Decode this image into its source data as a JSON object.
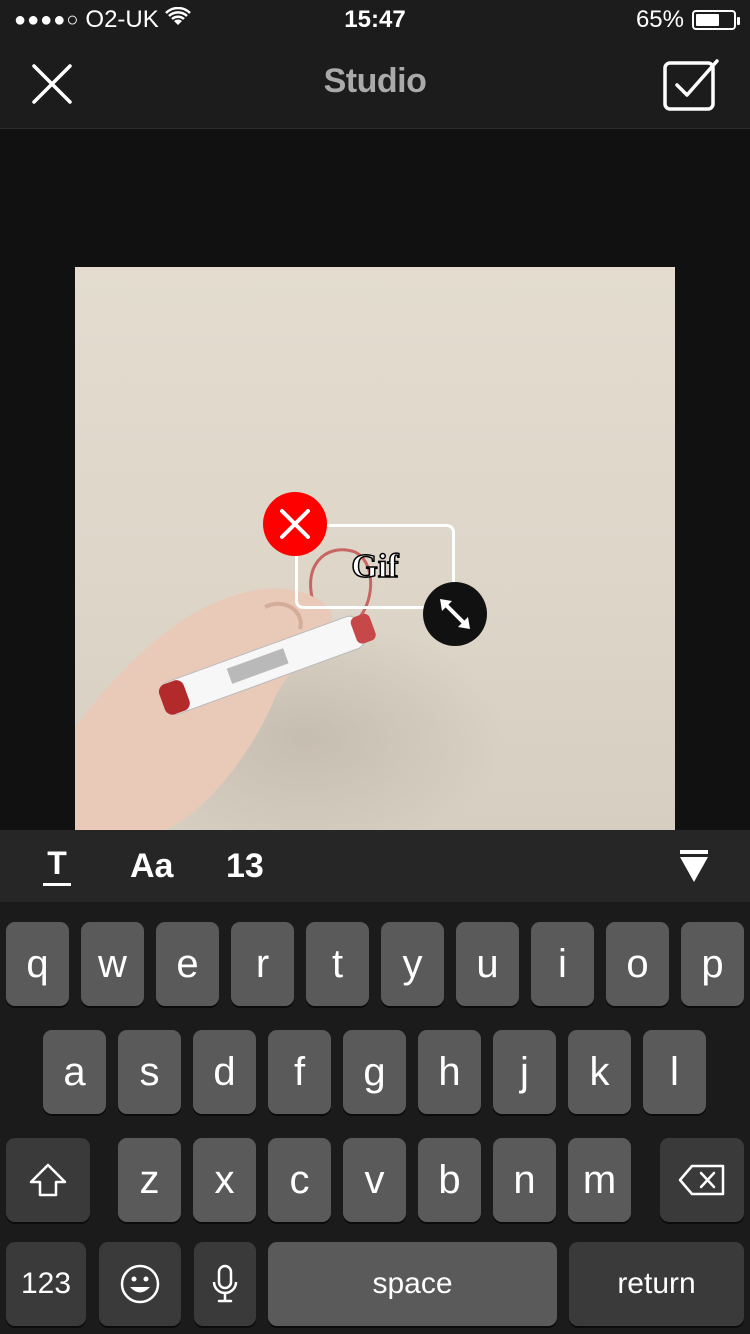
{
  "status_bar": {
    "signal_dots": "●●●●○",
    "carrier": "O2-UK",
    "time": "15:47",
    "battery_percent": "65%",
    "battery_level": 0.65
  },
  "nav": {
    "title": "Studio",
    "close_icon": "close-icon",
    "confirm_icon": "checkbox-confirm-icon"
  },
  "overlay": {
    "text": "Gif",
    "delete_icon": "delete-icon",
    "resize_icon": "resize-icon",
    "delete_color": "#ff0000"
  },
  "toolbar": {
    "text_style_label": "T",
    "font_label": "Aa",
    "size_label": "13",
    "collapse_icon": "arrow-down-icon"
  },
  "keyboard": {
    "row1": [
      "q",
      "w",
      "e",
      "r",
      "t",
      "y",
      "u",
      "i",
      "o",
      "p"
    ],
    "row2": [
      "a",
      "s",
      "d",
      "f",
      "g",
      "h",
      "j",
      "k",
      "l"
    ],
    "row3": [
      "z",
      "x",
      "c",
      "v",
      "b",
      "n",
      "m"
    ],
    "numbers_label": "123",
    "space_label": "space",
    "return_label": "return",
    "shift_icon": "shift-icon",
    "delete_icon": "backspace-icon",
    "emoji_icon": "emoji-icon",
    "mic_icon": "microphone-icon"
  }
}
